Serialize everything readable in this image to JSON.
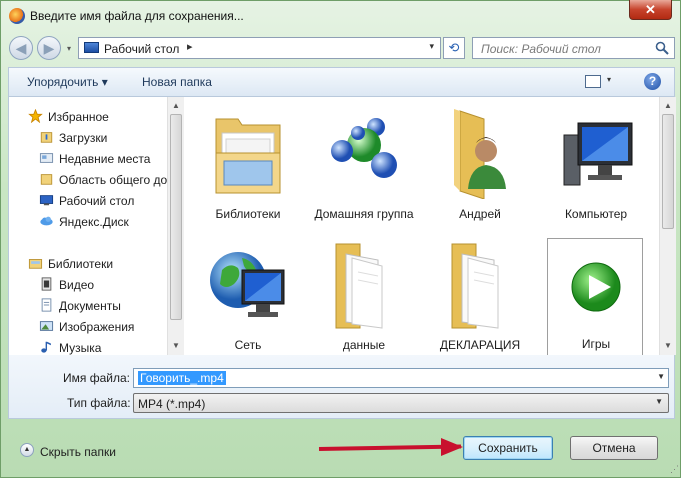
{
  "window": {
    "title": "Введите имя файла для сохранения...",
    "close_label": "✕"
  },
  "nav": {
    "back": "◀",
    "forward": "▶",
    "dropdown": "▾"
  },
  "address": {
    "path": "Рабочий стол",
    "separator": "▸",
    "dropdown": "▾"
  },
  "search": {
    "placeholder": "Поиск: Рабочий стол"
  },
  "toolbar": {
    "organize": "Упорядочить ▾",
    "new_folder": "Новая папка",
    "view_dd": "▾",
    "help": "?"
  },
  "sidebar": {
    "favorites": {
      "label": "Избранное",
      "items": [
        {
          "label": "Загрузки"
        },
        {
          "label": "Недавние места"
        },
        {
          "label": "Область общего доступа"
        },
        {
          "label": "Рабочий стол"
        },
        {
          "label": "Яндекс.Диск"
        }
      ]
    },
    "libraries": {
      "label": "Библиотеки",
      "items": [
        {
          "label": "Видео"
        },
        {
          "label": "Документы"
        },
        {
          "label": "Изображения"
        },
        {
          "label": "Музыка"
        }
      ]
    }
  },
  "items": [
    {
      "label": "Библиотеки",
      "icon": "libraries-folder-icon"
    },
    {
      "label": "Домашняя группа",
      "icon": "homegroup-icon"
    },
    {
      "label": "Андрей",
      "icon": "user-folder-icon"
    },
    {
      "label": "Компьютер",
      "icon": "computer-icon"
    },
    {
      "label": "Сеть",
      "icon": "network-icon"
    },
    {
      "label": "данные",
      "icon": "folder-icon"
    },
    {
      "label": "ДЕКЛАРАЦИЯ",
      "icon": "folder-icon"
    },
    {
      "label": "Игры",
      "icon": "games-icon"
    }
  ],
  "form": {
    "filename_label": "Имя файла:",
    "filename_value": "Говорить_.mp4",
    "filetype_label": "Тип файла:",
    "filetype_value": "MP4 (*.mp4)"
  },
  "footer": {
    "hide_folders": "Скрыть папки",
    "save": "Сохранить",
    "cancel": "Отмена"
  },
  "colors": {
    "accent_arrow": "#c8102e",
    "selection": "#3399ff",
    "window_frame": "#b9dcb3"
  }
}
